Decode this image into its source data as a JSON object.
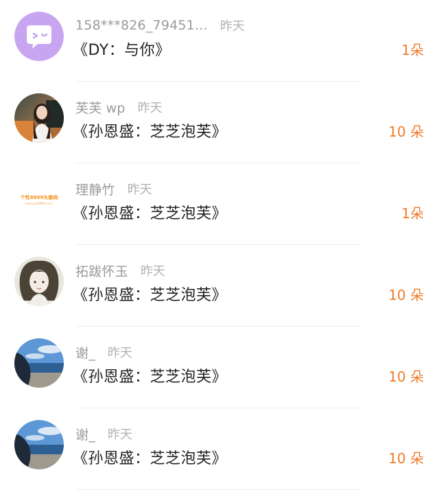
{
  "records": [
    {
      "avatar_icon": "speech-bubble-face-avatar",
      "name": "158***826_79451...",
      "time": "昨天",
      "gift": "《DY：与你》",
      "count": "1朵"
    },
    {
      "avatar_icon": "girl-photo-avatar",
      "name": "芙芙 wp",
      "time": "昨天",
      "gift": "《孙恩盛：芝芝泡芙》",
      "count": "10 朵"
    },
    {
      "avatar_icon": "watermark-logo-avatar",
      "avatar_text": "个性8899头像网",
      "avatar_subtext": "www.gx8899.com",
      "name": "理静竹",
      "time": "昨天",
      "gift": "《孙恩盛：芝芝泡芙》",
      "count": "1朵"
    },
    {
      "avatar_icon": "drawn-girl-avatar",
      "name": "拓跋怀玉",
      "time": "昨天",
      "gift": "《孙恩盛：芝芝泡芙》",
      "count": "10 朵"
    },
    {
      "avatar_icon": "beach-photo-avatar",
      "name": "谢_",
      "time": "昨天",
      "gift": "《孙恩盛：芝芝泡芙》",
      "count": "10 朵"
    },
    {
      "avatar_icon": "beach-photo-avatar",
      "name": "谢_",
      "time": "昨天",
      "gift": "《孙恩盛：芝芝泡芙》",
      "count": "10 朵"
    }
  ]
}
